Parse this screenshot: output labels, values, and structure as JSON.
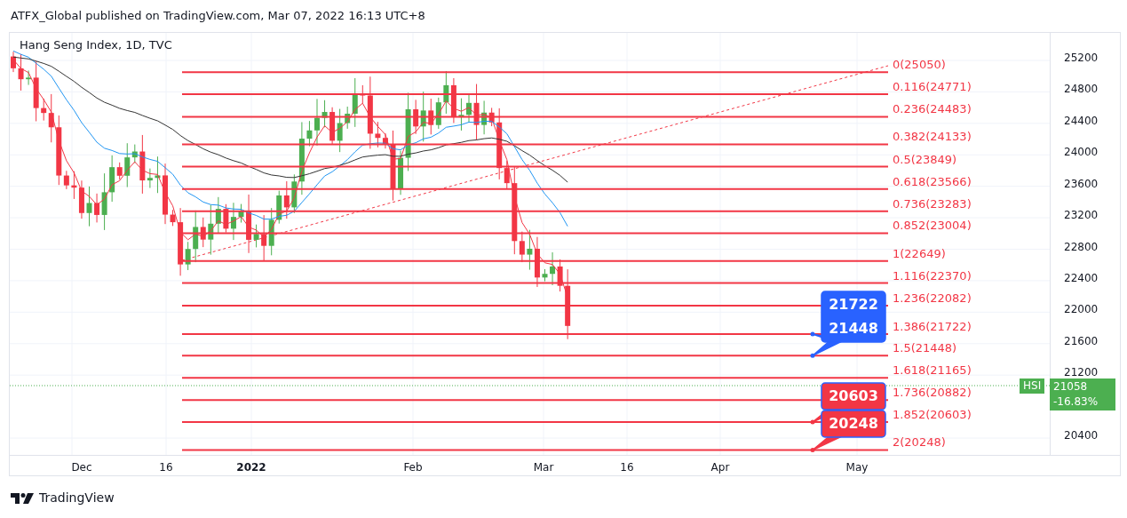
{
  "header": {
    "text": "ATFX_Global published on TradingView.com, Mar 07, 2022 16:13 UTC+8"
  },
  "chart": {
    "title": "Hang Seng Index, 1D, TVC",
    "fib_levels": [
      {
        "label": "0(25050)"
      },
      {
        "label": "0.116(24771)"
      },
      {
        "label": "0.236(24483)"
      },
      {
        "label": "0.382(24133)"
      },
      {
        "label": "0.5(23849)"
      },
      {
        "label": "0.618(23566)"
      },
      {
        "label": "0.736(23283)"
      },
      {
        "label": "0.852(23004)"
      },
      {
        "label": "1(22649)"
      },
      {
        "label": "1.116(22370)"
      },
      {
        "label": "1.236(22082)"
      },
      {
        "label": "1.386(21722)"
      },
      {
        "label": "1.5(21448)"
      },
      {
        "label": "1.618(21165)"
      },
      {
        "label": "1.736(20882)"
      },
      {
        "label": "1.852(20603)"
      },
      {
        "label": "2(20248)"
      }
    ],
    "callouts": [
      {
        "lines": [
          "21722",
          "21448"
        ],
        "color": "#2962ff"
      },
      {
        "lines": [
          "20603"
        ],
        "color": "#f23645"
      },
      {
        "lines": [
          "20248"
        ],
        "color": "#f23645"
      }
    ],
    "price_ticks": [
      "25200",
      "24800",
      "24400",
      "24000",
      "23600",
      "23200",
      "22800",
      "22400",
      "22000",
      "21600",
      "21200",
      "20400"
    ],
    "time_ticks": [
      {
        "label": "Dec",
        "bold": false
      },
      {
        "label": "16",
        "bold": false
      },
      {
        "label": "2022",
        "bold": true
      },
      {
        "label": "Feb",
        "bold": false
      },
      {
        "label": "Mar",
        "bold": false
      },
      {
        "label": "16",
        "bold": false
      },
      {
        "label": "Apr",
        "bold": false
      },
      {
        "label": "May",
        "bold": false
      }
    ],
    "price_tag": {
      "symbol": "HSI",
      "price": "21058",
      "change": "-16.83%"
    }
  },
  "footer": {
    "brand": "TradingView"
  }
}
